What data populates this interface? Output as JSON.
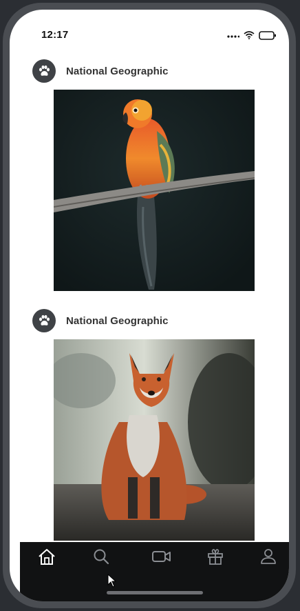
{
  "status_bar": {
    "time": "12:17",
    "icons": [
      "signal-icon",
      "wifi-icon",
      "battery-icon"
    ]
  },
  "feed": {
    "posts": [
      {
        "author": "National Geographic",
        "avatar_icon": "paw-icon",
        "image": "parrot-photo"
      },
      {
        "author": "National Geographic",
        "avatar_icon": "paw-icon",
        "image": "fox-photo"
      }
    ]
  },
  "tab_bar": {
    "tabs": [
      {
        "name": "home",
        "icon": "home-icon",
        "active": true
      },
      {
        "name": "search",
        "icon": "search-icon",
        "active": false
      },
      {
        "name": "video",
        "icon": "video-camera-icon",
        "active": false
      },
      {
        "name": "gifts",
        "icon": "gift-icon",
        "active": false
      },
      {
        "name": "profile",
        "icon": "profile-icon",
        "active": false
      }
    ]
  },
  "colors": {
    "tab_bar_bg": "#111213",
    "active_tab": "#ffffff",
    "inactive_tab": "#8b8e93",
    "avatar_bg": "#3f4246"
  }
}
